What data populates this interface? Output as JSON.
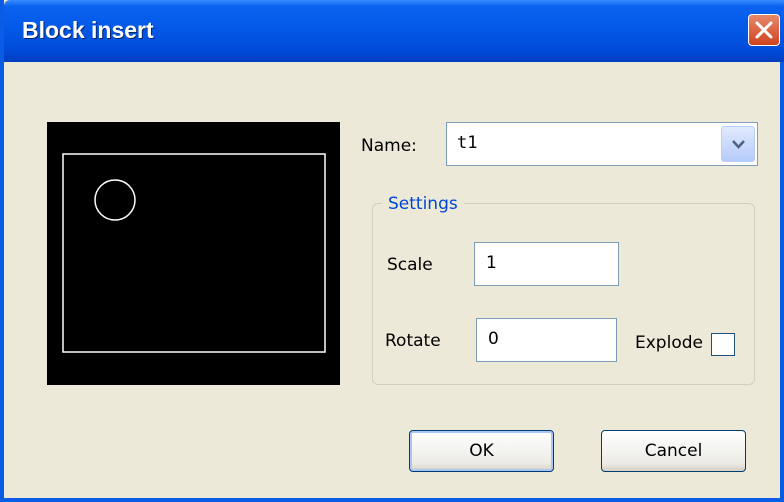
{
  "window": {
    "title": "Block insert"
  },
  "name_field": {
    "label": "Name:",
    "value": "t1"
  },
  "settings": {
    "group_title": "Settings",
    "scale_label": "Scale",
    "scale_value": "1",
    "rotate_label": "Rotate",
    "rotate_value": "0",
    "explode_label": "Explode",
    "explode_checked": false
  },
  "buttons": {
    "ok": "OK",
    "cancel": "Cancel"
  },
  "icons": {
    "close": "close-icon",
    "dropdown": "chevron-down-icon"
  },
  "colors": {
    "titlebar": "#0357E6",
    "preview_bg": "#000000",
    "preview_stroke": "#FFFFFF",
    "group_title": "#0046D5"
  }
}
